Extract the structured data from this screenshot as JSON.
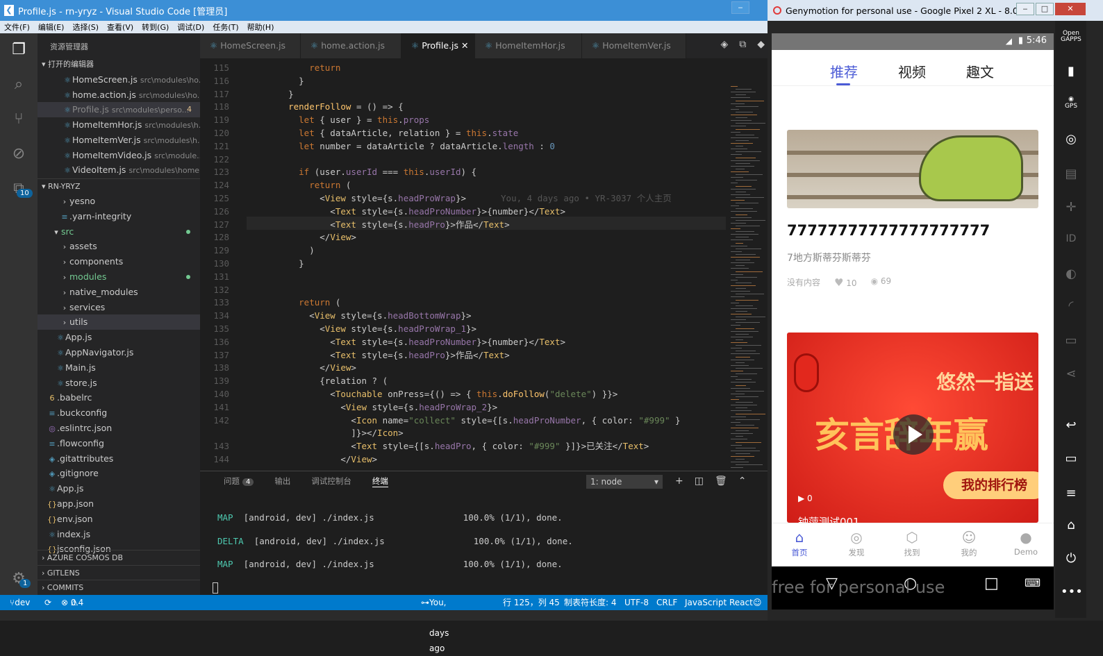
{
  "vscode": {
    "title": "Profile.js - rn-yryz - Visual Studio Code [管理员]",
    "menu": [
      "文件(F)",
      "编辑(E)",
      "选择(S)",
      "查看(V)",
      "转到(G)",
      "调试(D)",
      "任务(T)",
      "帮助(H)"
    ],
    "activity_badge_count": "10",
    "settings_badge": "1",
    "explorer_title": "资源管理器",
    "open_editors_label": "打开的编辑器",
    "open_editors": [
      {
        "name": "HomeScreen.js",
        "path": "src\\modules\\ho..."
      },
      {
        "name": "home.action.js",
        "path": "src\\modules\\ho..."
      },
      {
        "name": "Profile.js",
        "path": "src\\modules\\perso...",
        "count": "4"
      },
      {
        "name": "HomeItemHor.js",
        "path": "src\\modules\\h..."
      },
      {
        "name": "HomeItemVer.js",
        "path": "src\\modules\\h..."
      },
      {
        "name": "HomeItemVideo.js",
        "path": "src\\module..."
      },
      {
        "name": "VideoItem.js",
        "path": "src\\modules\\home..."
      }
    ],
    "project_label": "RN-YRYZ",
    "tree": [
      "yesno",
      ".yarn-integrity",
      "src",
      "assets",
      "components",
      "modules",
      "native_modules",
      "services",
      "utils",
      "App.js",
      "AppNavigator.js",
      "Main.js",
      "store.js",
      ".babelrc",
      ".buckconfig",
      ".eslintrc.json",
      ".flowconfig",
      ".gitattributes",
      ".gitignore",
      "App.js",
      "app.json",
      "env.json",
      "index.js",
      "jsconfig.json"
    ],
    "bottom_sections": [
      "AZURE COSMOS DB",
      "GITLENS",
      "COMMITS"
    ],
    "tabs": [
      "HomeScreen.js",
      "home.action.js",
      "Profile.js",
      "HomeItemHor.js",
      "HomeItemVer.js"
    ],
    "line_numbers": [
      "115",
      "116",
      "117",
      "118",
      "119",
      "120",
      "121",
      "122",
      "123",
      "124",
      "125",
      "126",
      "127",
      "128",
      "129",
      "130",
      "131",
      "132",
      "133",
      "134",
      "135",
      "136",
      "137",
      "138",
      "139",
      "140",
      "141",
      "142",
      "",
      "143",
      "144"
    ],
    "code_lines": [
      "        return",
      "      }",
      "    }",
      "    renderFollow = () => {",
      "      let { user } = this.props",
      "      let { dataArticle, relation } = this.state",
      "      let number = dataArticle ? dataArticle.length : 0",
      "",
      "      if (user.userId === this.userId) {",
      "        return (",
      "          <View style={s.headProWrap}>",
      "            <Text style={s.headProNumber}>{number}</Text>",
      "            <Text style={s.headPro}>作品</Text>",
      "          </View>",
      "        )",
      "      }",
      "",
      "",
      "      return (",
      "        <View style={s.headBottomWrap}>",
      "          <View style={s.headProWrap_1}>",
      "            <Text style={s.headProNumber}>{number}</Text>",
      "            <Text style={s.headPro}>作品</Text>",
      "          </View>",
      "          {relation ? (",
      "            <Touchable onPress={() => { this.doFollow(\"delete\") }}>",
      "              <View style={s.headProWrap_2}>",
      "                <Icon name=\"collect\" style={[s.headProNumber, { color: \"#999\" }",
      "                ]}></Icon>",
      "                <Text style={[s.headPro, { color: \"#999\" }]}>已关注</Text>",
      "              </View>"
    ],
    "blame": "You, 4 days ago • YR-3037 个人主页",
    "panel": {
      "tabs": [
        "问题",
        "输出",
        "调试控制台",
        "终端"
      ],
      "problems_count": "4",
      "terminal_select": "1: node",
      "lines": [
        {
          "tag": "MAP",
          "rest": "  [android, dev] ./index.js                 100.0% (1/1), done."
        },
        {
          "tag": "DELTA",
          "rest": "  [android, dev] ./index.js                 100.0% (1/1), done."
        },
        {
          "tag": "MAP",
          "rest": "  [android, dev] ./index.js                 100.0% (1/1), done."
        }
      ]
    },
    "status": {
      "branch": "dev",
      "errors": "0",
      "warnings": "4",
      "blame": "You, 4 days ago",
      "position": "行 125，列 45",
      "tab_size": "制表符长度: 4",
      "encoding": "UTF-8",
      "eol": "CRLF",
      "language": "JavaScript React"
    }
  },
  "genymotion": {
    "title": "Genymotion for personal use - Google Pixel 2 XL - 8.0 - ...",
    "watermark": "free for personal use",
    "side_icons": [
      "Open GAPPS",
      "battery-icon",
      "GPS",
      "camera-icon",
      "clapper-icon",
      "dpad-icon",
      "ID",
      "disk-icon",
      "rss-icon",
      "sms-icon",
      "share-icon",
      "back-icon",
      "recent-icon",
      "menu-icon",
      "home-icon",
      "power-icon",
      "more-icon"
    ],
    "app": {
      "time": "5:46",
      "tabs": [
        "推荐",
        "视频",
        "趣文"
      ],
      "card1": {
        "title": "77777777777777777777",
        "subtitle": "7地方斯蒂芬斯蒂芬",
        "no_content": "没有内容",
        "likes": "10",
        "views": "69"
      },
      "card2": {
        "banner_top": "悠然一指送",
        "banner_main": "亥言辞年赢",
        "banner_btn": "我的排行榜",
        "play_count": "0",
        "caption": "钟萍测试001"
      },
      "bottom_nav": [
        "首页",
        "发现",
        "找到",
        "我的",
        "Demo"
      ]
    }
  }
}
